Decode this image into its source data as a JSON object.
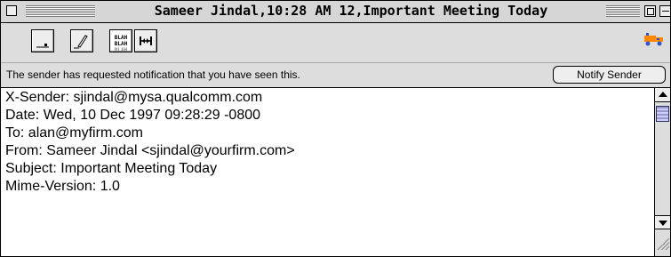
{
  "window": {
    "title": "Sameer Jindal,10:28 AM 12,Important Meeting Today"
  },
  "toolbar": {
    "icons": [
      "signature-icon",
      "pencil-edit-icon",
      "blah-text-icon",
      "width-icon",
      "priority-truck-icon"
    ],
    "blah_lines": [
      "BLAH",
      "BLAH",
      "BLAH"
    ]
  },
  "notification": {
    "message": "The sender has requested notification that you have seen this.",
    "button_label": "Notify Sender"
  },
  "message": {
    "header_lines": [
      "X-Sender: sjindal@mysa.qualcomm.com",
      "Date: Wed, 10 Dec 1997 09:28:29 -0800",
      "To: alan@myfirm.com",
      "From: Sameer Jindal <sjindal@yourfirm.com>",
      "Subject: Important Meeting Today",
      "Mime-Version: 1.0"
    ]
  },
  "colors": {
    "chrome": "#dddddd",
    "scroll_thumb": "#9999cc",
    "truck_orange": "#ff8800",
    "truck_blue": "#3355cc"
  }
}
